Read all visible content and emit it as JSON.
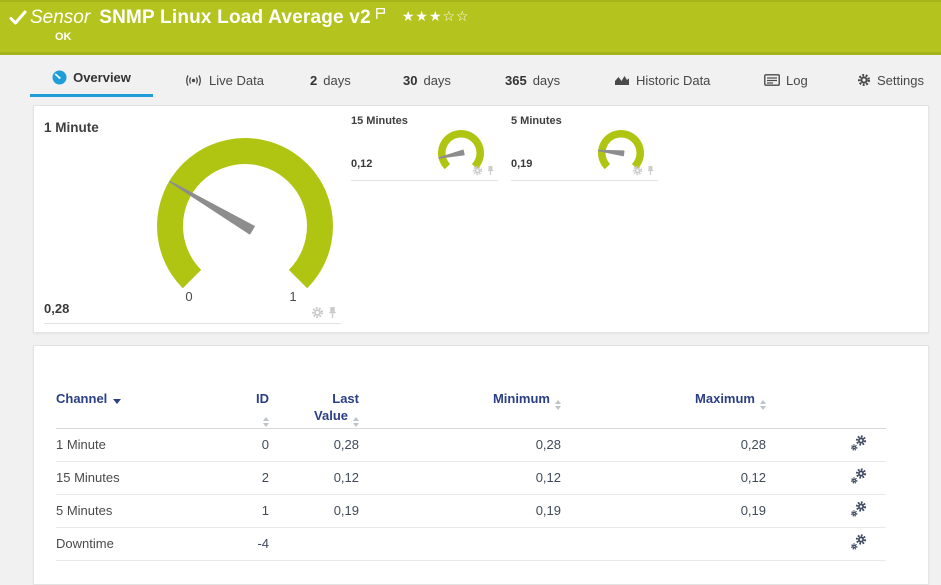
{
  "topbar": {
    "type_label": "Sensor",
    "title": "SNMP Linux Load Average v2",
    "status": "OK",
    "rating_full": "★★★",
    "rating_empty": "☆☆"
  },
  "tabs": [
    {
      "label": "Overview",
      "active": true
    },
    {
      "label": "Live Data"
    },
    {
      "prefix": "2",
      "label": "days"
    },
    {
      "prefix": "30",
      "label": "days"
    },
    {
      "prefix": "365",
      "label": "days"
    },
    {
      "label": "Historic Data"
    },
    {
      "label": "Log"
    },
    {
      "label": "Settings"
    }
  ],
  "gauges": [
    {
      "name": "1 Minute",
      "value": 0.28,
      "value_text": "0,28",
      "min": 0,
      "max": 1,
      "min_label": "0",
      "max_label": "1",
      "size": "large"
    },
    {
      "name": "15 Minutes",
      "value": 0.12,
      "value_text": "0,12",
      "min": 0,
      "max": 1,
      "size": "small"
    },
    {
      "name": "5 Minutes",
      "value": 0.19,
      "value_text": "0,19",
      "min": 0,
      "max": 1,
      "size": "small"
    }
  ],
  "table": {
    "columns": {
      "channel": "Channel",
      "id": "ID",
      "last_1": "Last",
      "last_2": "Value",
      "min": "Minimum",
      "max": "Maximum"
    },
    "rows": [
      {
        "channel": "1 Minute",
        "id": "0",
        "last": "0,28",
        "min": "0,28",
        "max": "0,28"
      },
      {
        "channel": "15 Minutes",
        "id": "2",
        "last": "0,12",
        "min": "0,12",
        "max": "0,12"
      },
      {
        "channel": "5 Minutes",
        "id": "1",
        "last": "0,19",
        "min": "0,19",
        "max": "0,19"
      },
      {
        "channel": "Downtime",
        "id": "-4",
        "last": "",
        "min": "",
        "max": ""
      }
    ]
  },
  "colors": {
    "ok_green": "#b4c31d",
    "gauge_green": "#b0c412",
    "needle_gray": "#8d8d8d",
    "accent_blue": "#1f9dd9",
    "header_navy": "#2a3f85"
  }
}
